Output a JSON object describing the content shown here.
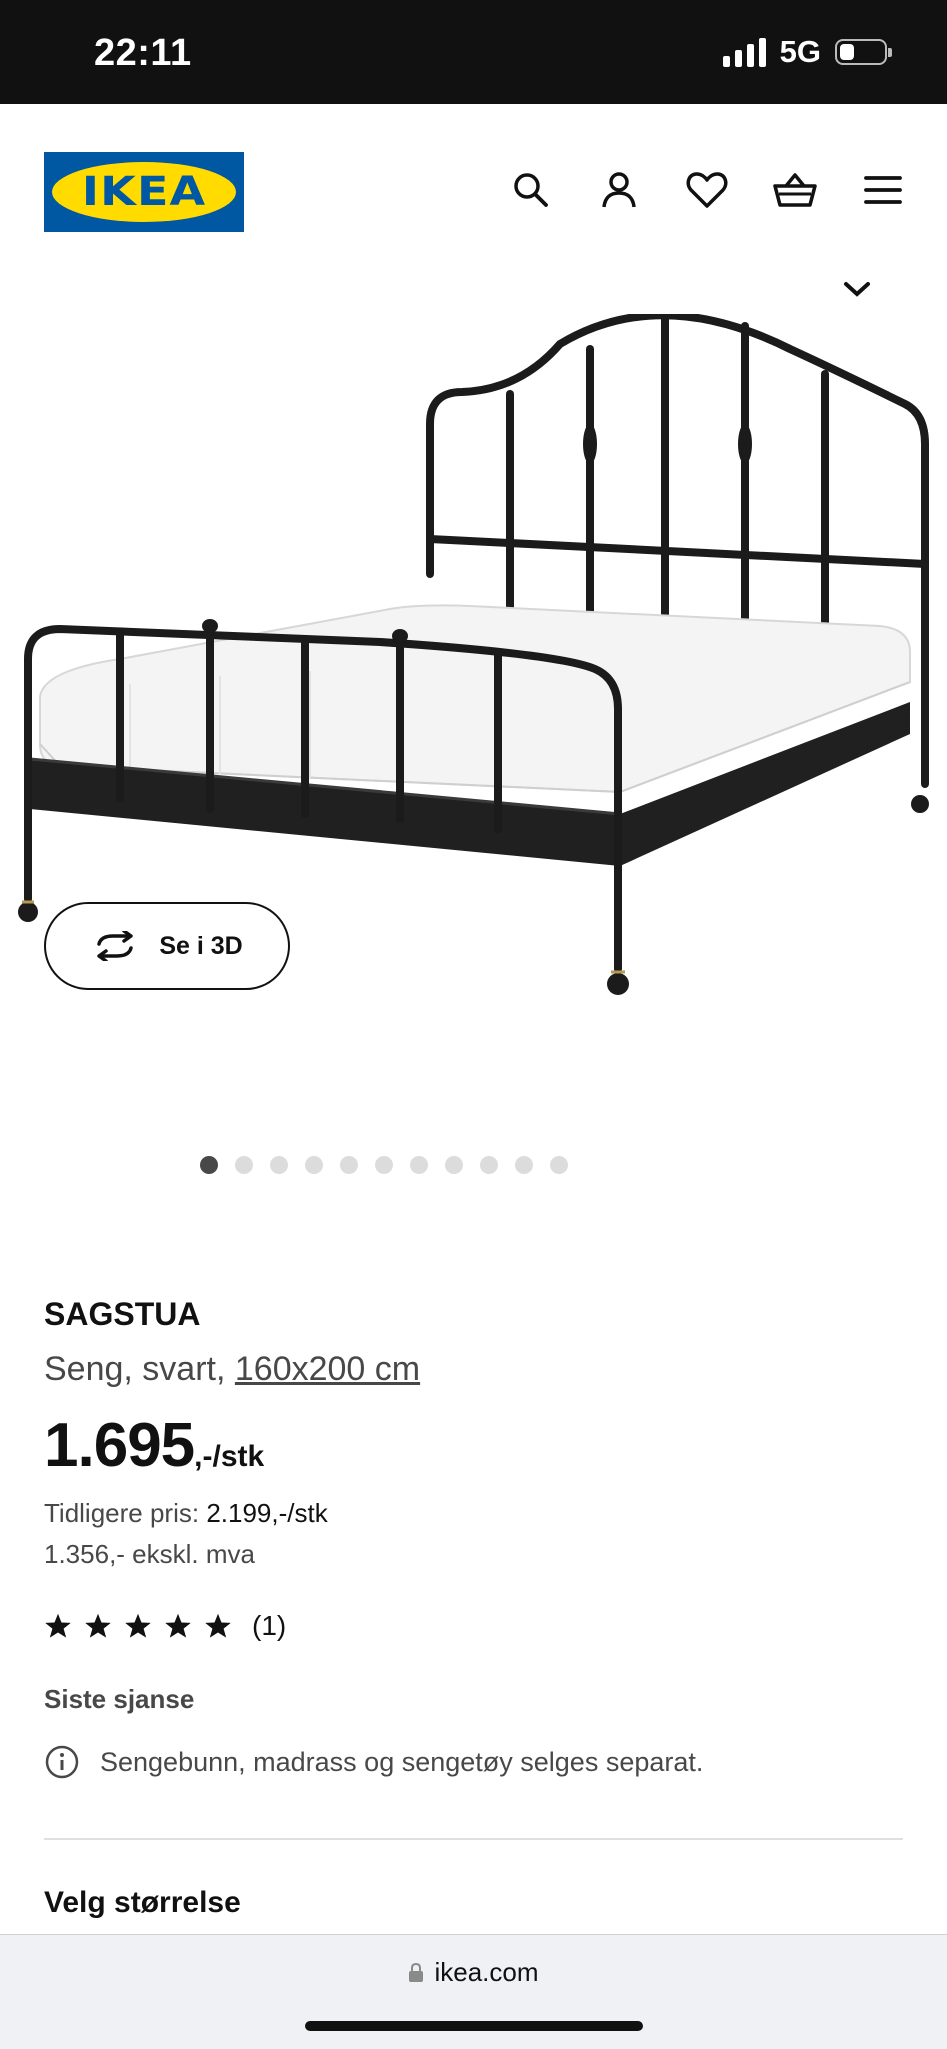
{
  "status": {
    "time": "22:11",
    "network": "5G",
    "battery_level": 0.3
  },
  "header": {
    "logo_text": "IKEA",
    "icons": [
      "search-icon",
      "user-icon",
      "heart-icon",
      "basket-icon",
      "menu-icon"
    ]
  },
  "gallery": {
    "view3d_label": "Se i 3D",
    "image_count": 11,
    "active_index": 0
  },
  "product": {
    "name": "SAGSTUA",
    "description_prefix": "Seng, svart, ",
    "size_link": "160x200 cm",
    "price_int": "1.695",
    "price_unit": ",-/stk",
    "previous_label": "Tidligere pris: ",
    "previous_value": "2.199,-/stk",
    "excl_vat": "1.356,- ekskl. mva",
    "rating_stars": 5,
    "rating_count": "(1)",
    "last_chance": "Siste sjanse",
    "info_text": "Sengebunn, madrass og sengetøy selges separat.",
    "size_heading": "Velg størrelse"
  },
  "browser": {
    "url": "ikea.com"
  },
  "colors": {
    "ikea_blue": "#0058A3",
    "ikea_yellow": "#FFDB00"
  }
}
